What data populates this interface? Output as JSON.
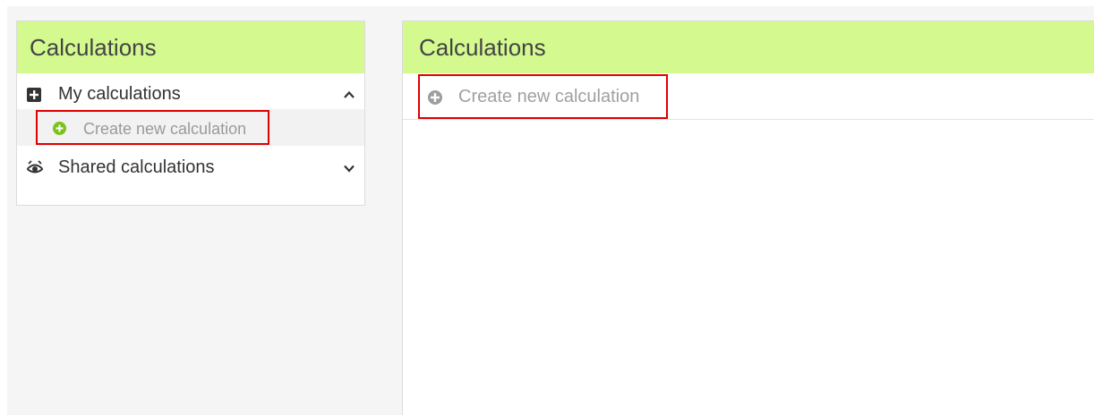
{
  "sidebar": {
    "header": "Calculations",
    "my_calculations": {
      "label": "My calculations",
      "expanded": true
    },
    "create_new": {
      "label": "Create new calculation"
    },
    "shared_calculations": {
      "label": "Shared calculations",
      "expanded": false
    }
  },
  "main": {
    "header": "Calculations",
    "create_new_button": {
      "label": "Create new calculation"
    }
  },
  "colors": {
    "header_bg": "#d3f98f",
    "highlight_border": "#e00000",
    "add_icon_green": "#7cc21b",
    "add_icon_gray": "#9e9e9e"
  },
  "icons": {
    "my_calculations": "plus-square-icon",
    "create_new_sidebar": "plus-circle-icon",
    "shared_calculations": "shared-eye-icon",
    "expanded": "chevron-up-icon",
    "collapsed": "chevron-down-icon",
    "create_new_main": "plus-circle-icon"
  }
}
